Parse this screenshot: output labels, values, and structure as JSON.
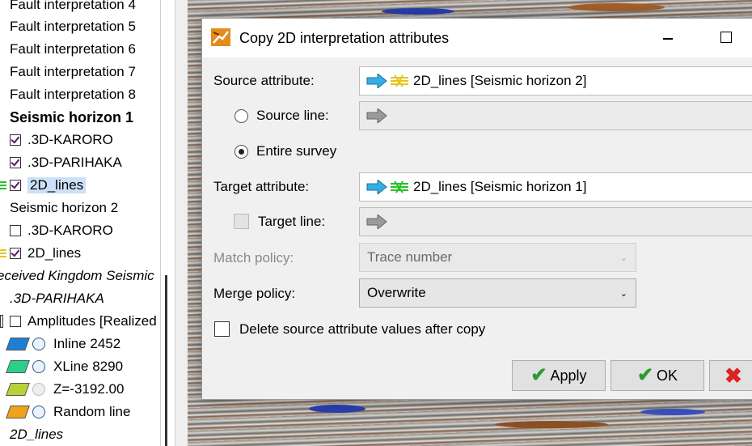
{
  "tree": {
    "rows": [
      {
        "text": "Fault interpretation 4",
        "style": "normal"
      },
      {
        "text": "Fault interpretation 5",
        "style": "normal"
      },
      {
        "text": "Fault interpretation 6",
        "style": "normal"
      },
      {
        "text": "Fault interpretation 7",
        "style": "normal"
      },
      {
        "text": "Fault interpretation 8",
        "style": "normal"
      },
      {
        "text": "Seismic horizon 1",
        "style": "bold"
      },
      {
        "text": ".3D-KARORO",
        "checked": true
      },
      {
        "text": ".3D-PARIHAKA",
        "checked": true
      },
      {
        "text": "2D_lines",
        "checked": true,
        "selected": true
      },
      {
        "text": "Seismic horizon 2",
        "style": "normal"
      },
      {
        "text": ".3D-KARORO",
        "checked": false
      },
      {
        "text": "2D_lines",
        "checked": true
      },
      {
        "text": "eceived Kingdom Seismic ",
        "style": "italic"
      },
      {
        "text": ".3D-PARIHAKA",
        "style": "italic"
      },
      {
        "text": "Amplitudes [Realized",
        "checked": false
      },
      {
        "text": "Inline 2452",
        "plane_color": "#1f7fd6"
      },
      {
        "text": "XLine 8290",
        "plane_color": "#2ccf8a"
      },
      {
        "text": "Z=-3192.00",
        "plane_color": "#b6d23a"
      },
      {
        "text": "Random line",
        "plane_color": "#f0a21a"
      },
      {
        "text": "2D_lines",
        "style": "italic"
      }
    ]
  },
  "dialog": {
    "title": "Copy 2D interpretation attributes",
    "source_attribute_label": "Source attribute:",
    "source_attribute_value": "2D_lines [Seismic horizon 2]",
    "source_line_label": "Source line:",
    "entire_survey_label": "Entire survey",
    "target_attribute_label": "Target attribute:",
    "target_attribute_value": "2D_lines [Seismic horizon 1]",
    "target_line_label": "Target line:",
    "match_policy_label": "Match policy:",
    "match_policy_value": "Trace number",
    "merge_policy_label": "Merge policy:",
    "merge_policy_value": "Overwrite",
    "delete_label": "Delete source attribute values after copy",
    "apply_label": "Apply",
    "ok_label": "OK",
    "source_line_selected": false,
    "entire_survey_selected": true,
    "target_line_checked": false,
    "delete_checked": false
  },
  "colors": {
    "arrow_blue": "#35aee6",
    "source_horizon_icon": "#e5c61a",
    "target_horizon_icon": "#27c227",
    "apply_check": "#2f9a2f",
    "cancel_x": "#d22222"
  }
}
